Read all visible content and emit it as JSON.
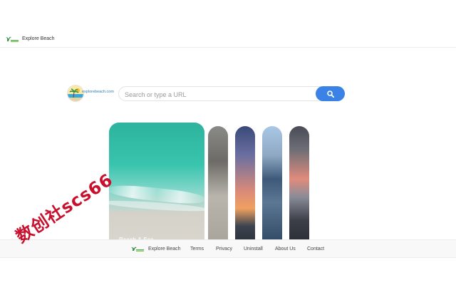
{
  "header": {
    "logo_text": "ExploreBeach",
    "title": "Explore Beach"
  },
  "brand": {
    "logo_text": "explorebeach.com"
  },
  "search": {
    "placeholder": "Search or type a URL",
    "icon": "search-icon"
  },
  "cards": [
    {
      "name": "turquoise-beach-card",
      "caption": "Beach & Sea..."
    },
    {
      "name": "rock-card"
    },
    {
      "name": "sunset-sea-card"
    },
    {
      "name": "pebbles-card"
    },
    {
      "name": "dusk-sea-card"
    }
  ],
  "footer": {
    "logo_text": "ExploreBeach",
    "brand_label": "Explore Beach",
    "links": [
      "Terms",
      "Privacy",
      "Uninstall",
      "About Us",
      "Contact"
    ]
  },
  "watermark": {
    "text": "数创社scs66"
  },
  "colors": {
    "accent": "#3b82e6",
    "watermark": "#c8102e"
  }
}
